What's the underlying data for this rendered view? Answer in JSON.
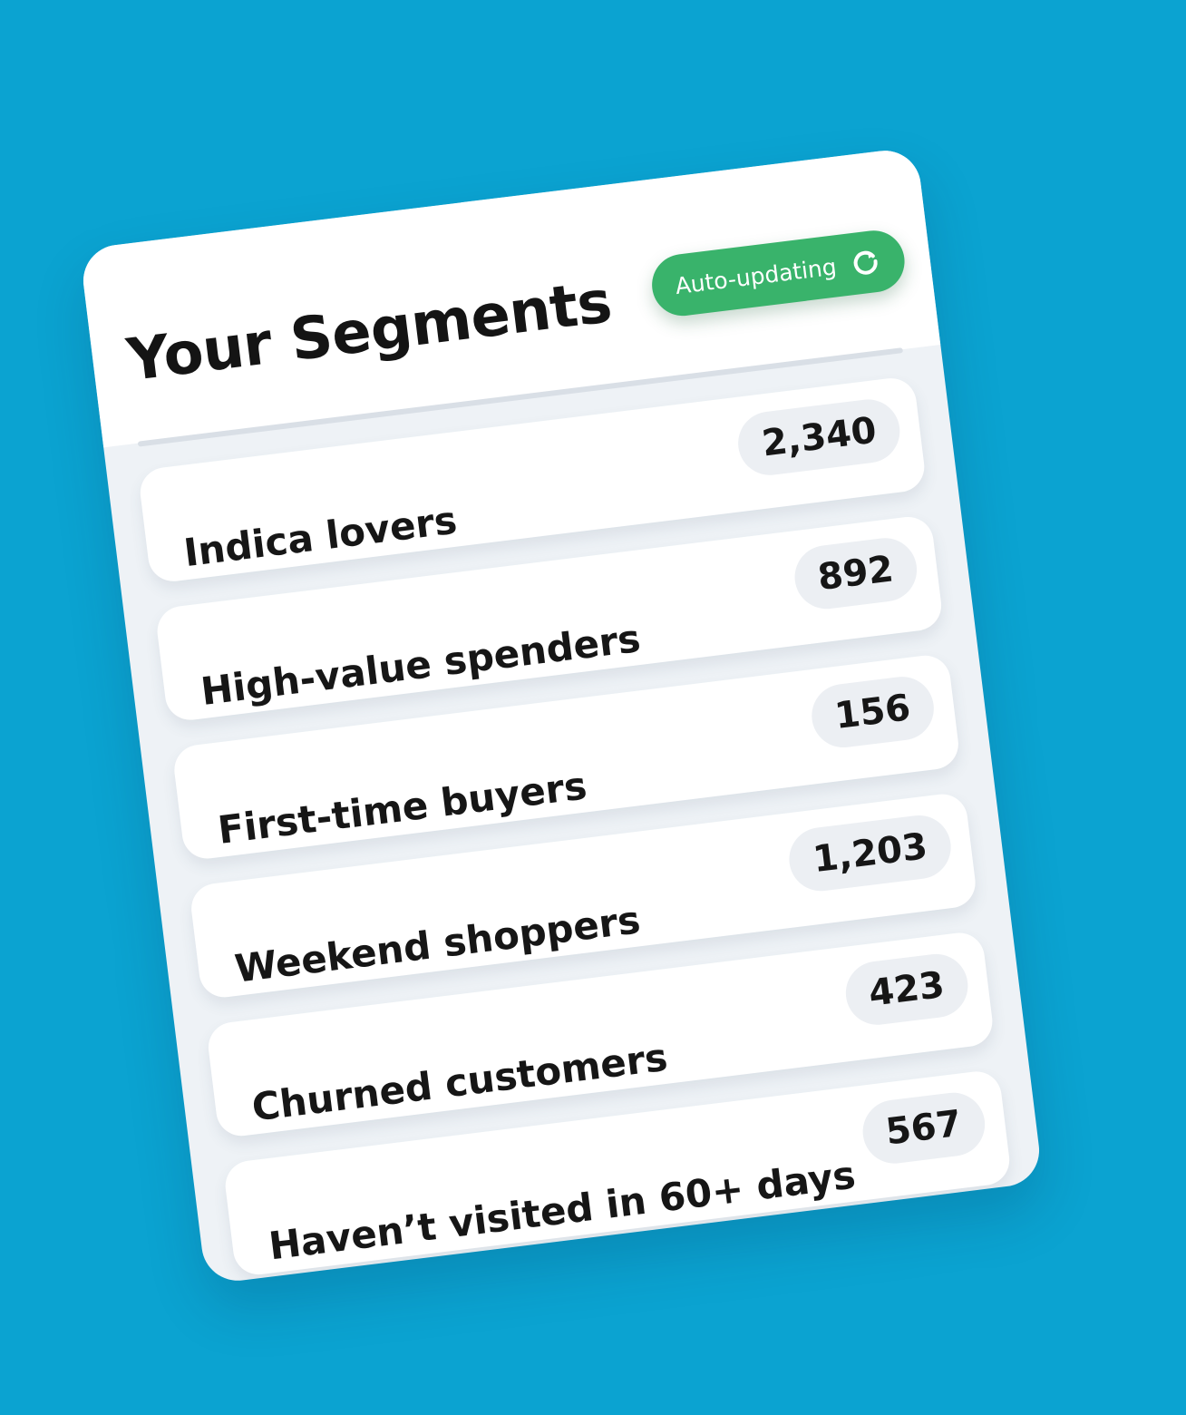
{
  "header": {
    "title": "Your Segments",
    "badge_label": "Auto-updating",
    "badge_icon": "refresh-icon",
    "badge_color": "#39b36b"
  },
  "segments": [
    {
      "label": "Indica lovers",
      "count": "2,340"
    },
    {
      "label": "High-value spenders",
      "count": "892"
    },
    {
      "label": "First-time buyers",
      "count": "156"
    },
    {
      "label": "Weekend shoppers",
      "count": "1,203"
    },
    {
      "label": "Churned customers",
      "count": "423"
    },
    {
      "label": "Haven’t visited in 60+ days",
      "count": "567"
    }
  ],
  "colors": {
    "background": "#0ba3d1",
    "card": "#ffffff",
    "text": "#161616"
  }
}
